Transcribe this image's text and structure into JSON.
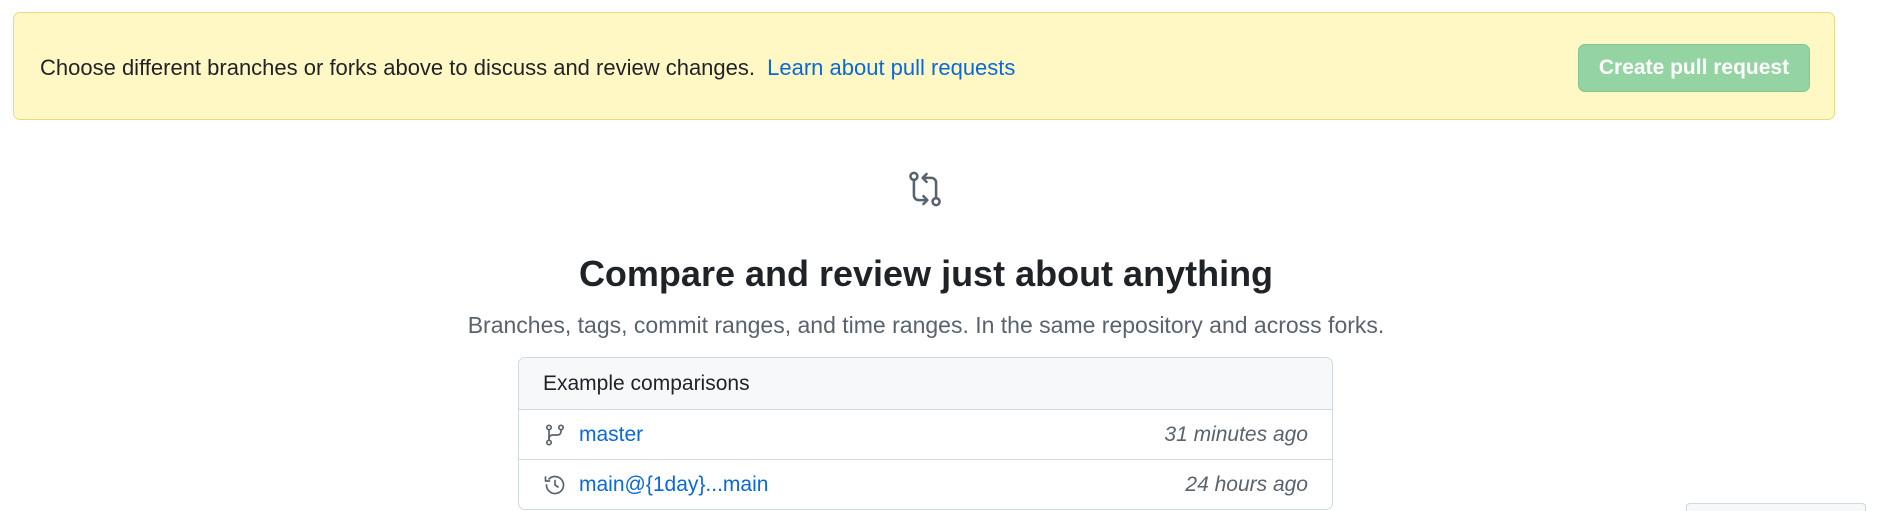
{
  "banner": {
    "message": "Choose different branches or forks above to discuss and review changes.",
    "link_label": "Learn about pull requests",
    "button_label": "Create pull request"
  },
  "blankslate": {
    "icon": "git-compare-icon",
    "title": "Compare and review just about anything",
    "description": "Branches, tags, commit ranges, and time ranges. In the same repository and across forks."
  },
  "examples": {
    "header": "Example comparisons",
    "rows": [
      {
        "icon": "git-branch-icon",
        "label": "master",
        "time": "31 minutes ago"
      },
      {
        "icon": "history-icon",
        "label": "main@{1day}...main",
        "time": "24 hours ago"
      }
    ]
  },
  "colors": {
    "banner_bg": "#fff8c5",
    "link": "#0969da",
    "button_disabled_bg": "#94d3a2"
  }
}
